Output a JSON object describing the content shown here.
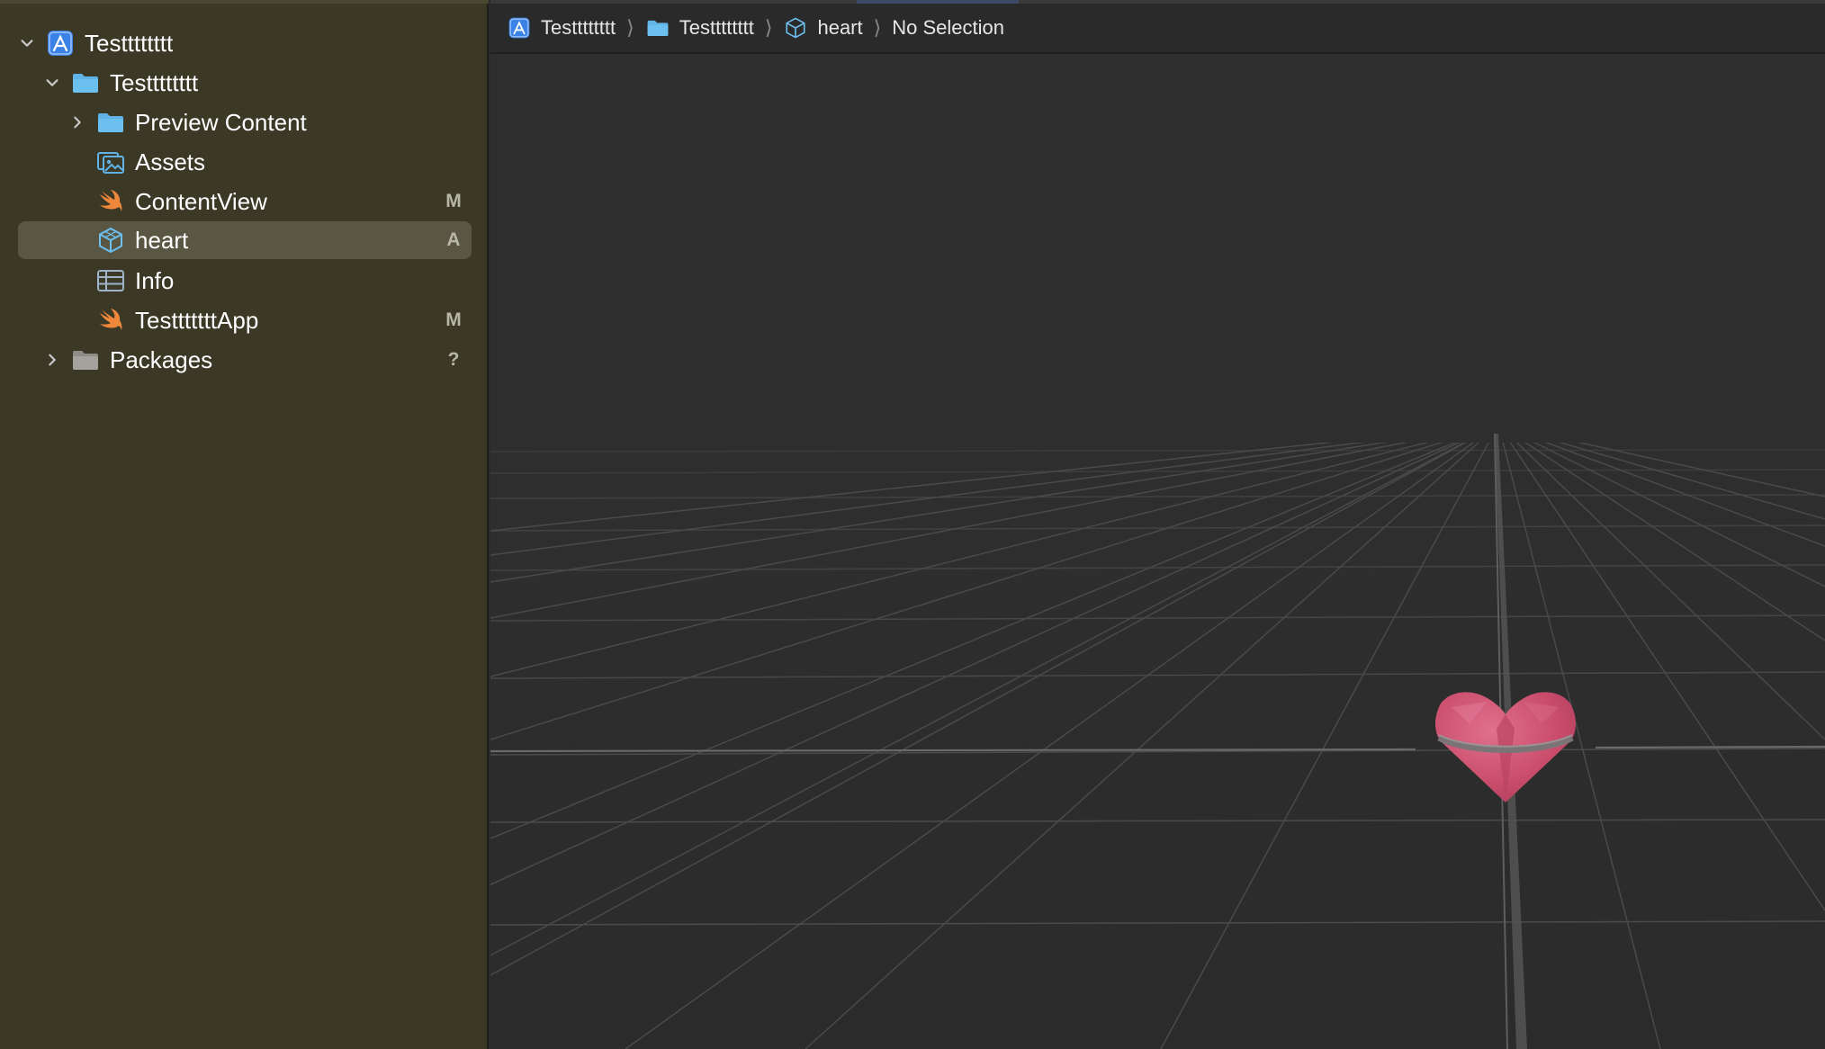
{
  "sidebar": {
    "items": [
      {
        "label": "Testttttttt",
        "icon": "xcode-project-icon",
        "badge": "",
        "expanded": "open",
        "selected": false
      },
      {
        "label": "Testttttttt",
        "icon": "folder-icon",
        "badge": "",
        "expanded": "open",
        "selected": false
      },
      {
        "label": "Preview Content",
        "icon": "folder-icon",
        "badge": "",
        "expanded": "closed",
        "selected": false
      },
      {
        "label": "Assets",
        "icon": "asset-catalog-icon",
        "badge": "",
        "expanded": "none",
        "selected": false
      },
      {
        "label": "ContentView",
        "icon": "swift-file-icon",
        "badge": "M",
        "expanded": "none",
        "selected": false
      },
      {
        "label": "heart",
        "icon": "3d-model-icon",
        "badge": "A",
        "expanded": "none",
        "selected": true
      },
      {
        "label": "Info",
        "icon": "plist-table-icon",
        "badge": "",
        "expanded": "none",
        "selected": false
      },
      {
        "label": "TestttttttApp",
        "icon": "swift-file-icon",
        "badge": "M",
        "expanded": "none",
        "selected": false
      },
      {
        "label": "Packages",
        "icon": "folder-gray-icon",
        "badge": "?",
        "expanded": "closed",
        "selected": false
      }
    ]
  },
  "jumpbar": {
    "crumbs": [
      {
        "label": "Testttttttt",
        "icon": "xcode-project-icon"
      },
      {
        "label": "Testttttttt",
        "icon": "folder-icon"
      },
      {
        "label": "heart",
        "icon": "3d-model-icon"
      },
      {
        "label": "No Selection",
        "icon": ""
      }
    ],
    "separator": "⟩"
  },
  "viewport": {
    "model": "heart",
    "model_color": "#c9506e",
    "grid_color": "#555555",
    "background": "#2e2e2e"
  },
  "colors": {
    "sidebar_bg": "#3b3826",
    "selection_bg": "#5a5644",
    "folder_blue": "#5fb3e6",
    "swift_orange": "#f0883c",
    "project_blue": "#3b82e6"
  }
}
